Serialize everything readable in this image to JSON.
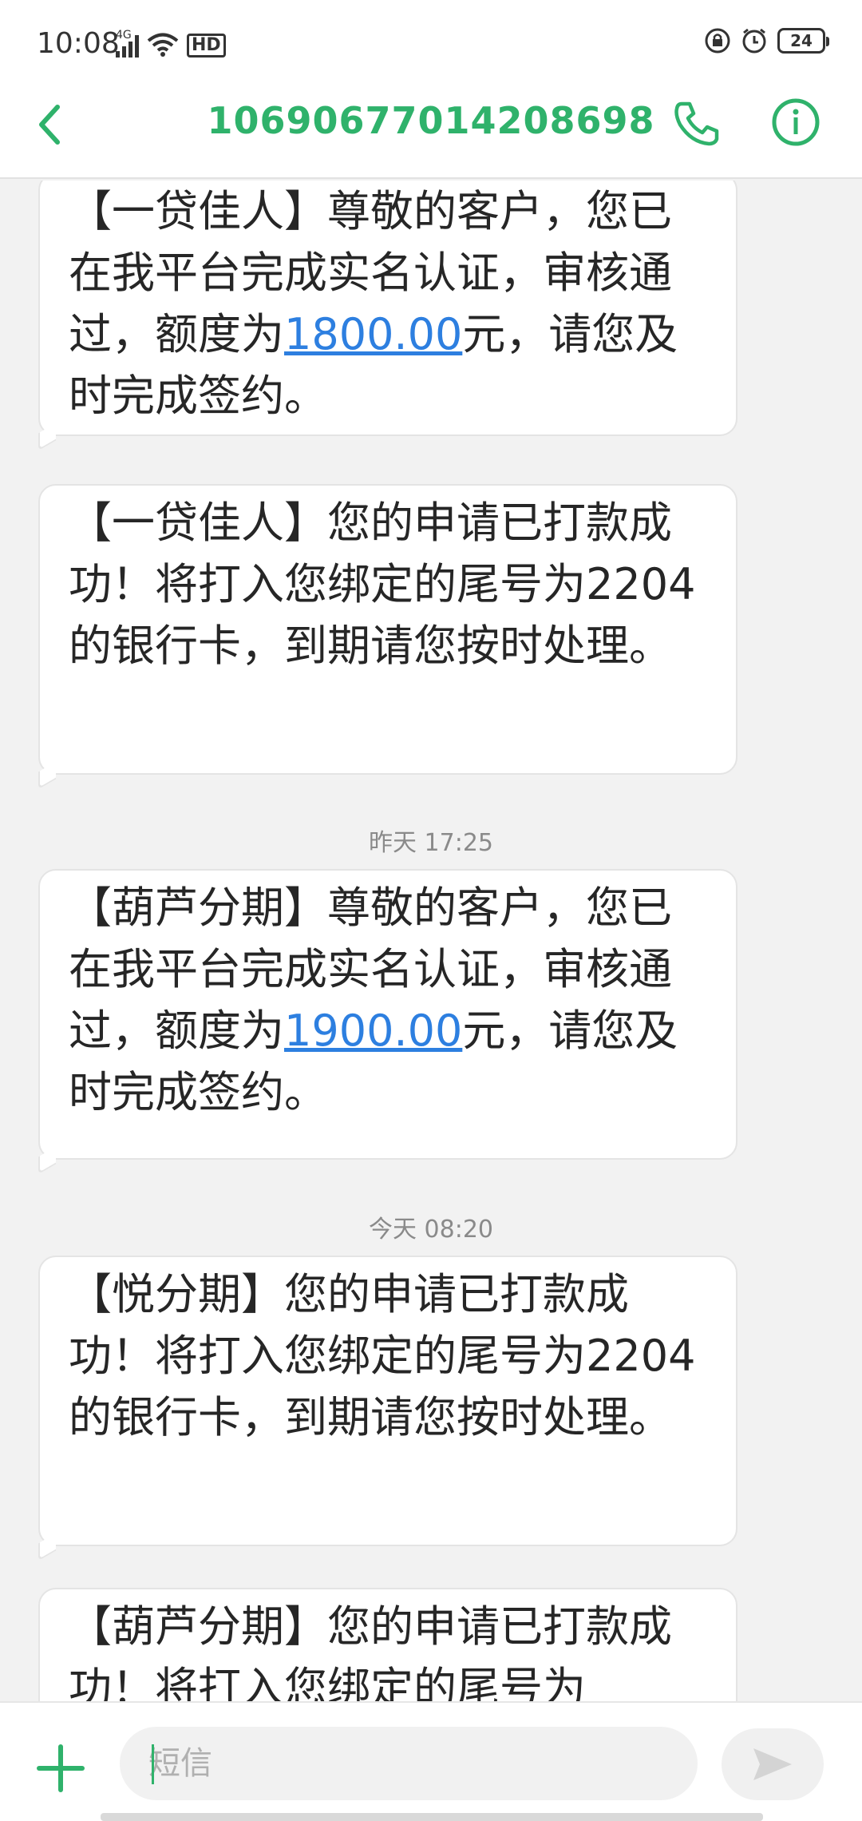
{
  "status_bar": {
    "time": "10:08",
    "network_tag": "4G",
    "hd_label": "HD",
    "battery": "24"
  },
  "header": {
    "back_icon": "chevron-left-icon",
    "title": "10690677014208698",
    "call_icon": "phone-icon",
    "info_icon": "info-icon",
    "accent_color": "#2fb26b"
  },
  "messages": [
    {
      "text_before": "【一贷佳人】尊敬的客户，您已在我平台完成实名认证，审核通过，额度为",
      "link": "1800.00",
      "text_after": "元，请您及时完成签约。"
    },
    {
      "text_before": "【一贷佳人】您的申请已打款成功！将打入您绑定的尾号为2204的银行卡，到期请您按时处理。",
      "link": "",
      "text_after": ""
    },
    {
      "timestamp": "昨天 17:25"
    },
    {
      "text_before": "【葫芦分期】尊敬的客户，您已在我平台完成实名认证，审核通过，额度为",
      "link": "1900.00",
      "text_after": "元，请您及时完成签约。"
    },
    {
      "timestamp": "今天 08:20"
    },
    {
      "text_before": "【悦分期】您的申请已打款成功！将打入您绑定的尾号为2204的银行卡，到期请您按时处理。",
      "link": "",
      "text_after": ""
    },
    {
      "text_before": "【葫芦分期】您的申请已打款成功！将打入您绑定的尾号为",
      "link": "",
      "text_after": ""
    }
  ],
  "input_bar": {
    "add_icon": "plus-icon",
    "placeholder": "短信",
    "send_icon": "send-icon"
  }
}
